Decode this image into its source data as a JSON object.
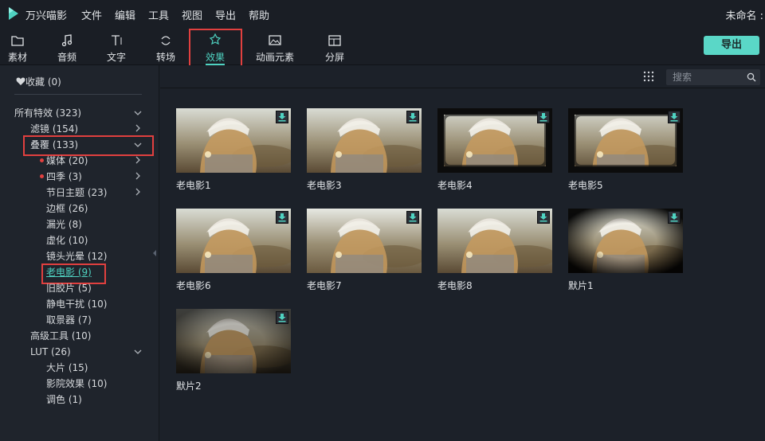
{
  "menubar": {
    "app_name": "万兴喵影",
    "items": [
      "文件",
      "编辑",
      "工具",
      "视图",
      "导出",
      "帮助"
    ],
    "document_name": "未命名 :"
  },
  "toolbar": {
    "tools": [
      {
        "label": "素材",
        "icon": "folder-icon"
      },
      {
        "label": "音频",
        "icon": "music-note-icon"
      },
      {
        "label": "文字",
        "icon": "text-icon"
      },
      {
        "label": "转场",
        "icon": "transition-icon"
      },
      {
        "label": "效果",
        "icon": "effects-icon",
        "active": true
      },
      {
        "label": "动画元素",
        "icon": "image-icon"
      },
      {
        "label": "分屏",
        "icon": "split-screen-icon"
      }
    ],
    "export_label": "导出"
  },
  "sidebar": {
    "favorites": "收藏 (0)",
    "all_effects": "所有特效 (323)",
    "items": [
      {
        "label": "滤镜 (154)"
      },
      {
        "label": "叠覆 (133)"
      },
      {
        "label": "媒体 (20)"
      },
      {
        "label": "四季 (3)"
      },
      {
        "label": "节日主题 (23)"
      },
      {
        "label": "边框 (26)"
      },
      {
        "label": "漏光 (8)"
      },
      {
        "label": "虚化 (10)"
      },
      {
        "label": "镜头光晕 (12)"
      },
      {
        "label": "老电影 (9)"
      },
      {
        "label": "旧胶片 (5)"
      },
      {
        "label": "静电干扰 (10)"
      },
      {
        "label": "取景器 (7)"
      },
      {
        "label": "高级工具 (10)"
      },
      {
        "label": "LUT (26)"
      },
      {
        "label": "大片 (15)"
      },
      {
        "label": "影院效果 (10)"
      },
      {
        "label": "调色 (1)"
      }
    ]
  },
  "content": {
    "search_placeholder": "搜索",
    "cards": [
      {
        "label": "老电影1",
        "style": "normal"
      },
      {
        "label": "老电影3",
        "style": "normal"
      },
      {
        "label": "老电影4",
        "style": "frame"
      },
      {
        "label": "老电影5",
        "style": "frame"
      },
      {
        "label": "老电影6",
        "style": "normal"
      },
      {
        "label": "老电影7",
        "style": "bright"
      },
      {
        "label": "老电影8",
        "style": "normal"
      },
      {
        "label": "默片1",
        "style": "vignette"
      },
      {
        "label": "默片2",
        "style": "dark"
      }
    ]
  },
  "colors": {
    "accent": "#4fd2c1",
    "highlight_box": "#e1403f",
    "export_button": "#5ad7c7"
  }
}
